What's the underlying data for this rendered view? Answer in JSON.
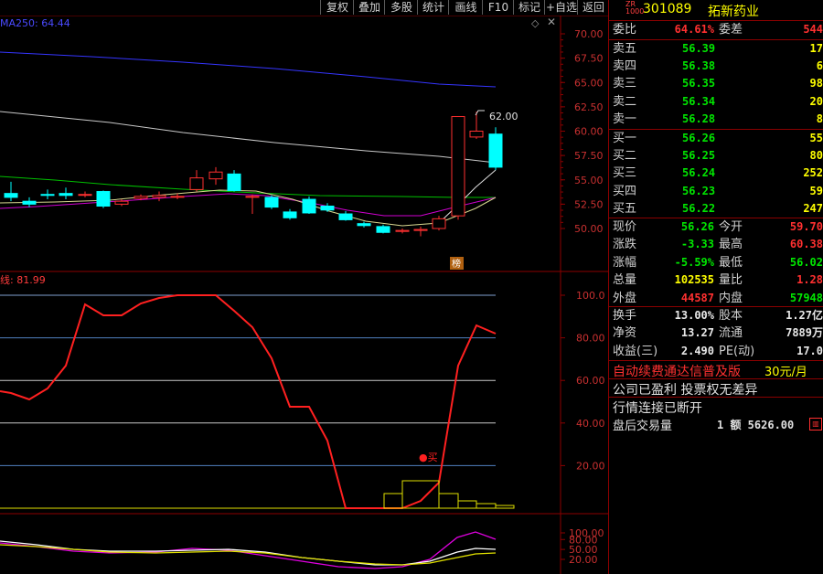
{
  "toolbar": {
    "items": [
      "复权",
      "叠加",
      "多股",
      "统计",
      "画线",
      "F10",
      "标记",
      "+自选",
      "返回"
    ]
  },
  "main_chart": {
    "ma_label": "MA250: 64.44",
    "peak_label": "62.00",
    "y_ticks": [
      "70.00",
      "67.50",
      "65.00",
      "62.50",
      "60.00",
      "57.50",
      "55.00",
      "52.50",
      "50.00"
    ],
    "badge": "榜",
    "close_icon": "close-icon",
    "diamond_icon": "diamond-icon",
    "colors": {
      "up": "#ff3030",
      "down": "#00ffff",
      "ma250": "#3535ff",
      "ma_white": "#c8c8c8",
      "ma_green": "#00c000",
      "ma_magenta": "#d000d0",
      "ma_yellow": "#ffff60"
    }
  },
  "indicator": {
    "label": "线: 81.99",
    "buy_label": "●买",
    "y_ticks": [
      "100.0",
      "80.00",
      "60.00",
      "40.00",
      "20.00"
    ]
  },
  "sub_indicator": {
    "y_ticks": [
      "100.00",
      "80.00",
      "50.00",
      "20.00"
    ]
  },
  "stock": {
    "market_tag": "ZR\n1000",
    "code": "301089",
    "name": "拓新药业"
  },
  "weibi": {
    "label": "委比",
    "value": "64.61%",
    "label2": "委差",
    "value2": "544"
  },
  "asks": [
    {
      "label": "卖五",
      "price": "56.39",
      "vol": "17"
    },
    {
      "label": "卖四",
      "price": "56.38",
      "vol": "6"
    },
    {
      "label": "卖三",
      "price": "56.35",
      "vol": "98"
    },
    {
      "label": "卖二",
      "price": "56.34",
      "vol": "20"
    },
    {
      "label": "卖一",
      "price": "56.28",
      "vol": "8"
    }
  ],
  "bids": [
    {
      "label": "买一",
      "price": "56.26",
      "vol": "55"
    },
    {
      "label": "买二",
      "price": "56.25",
      "vol": "80"
    },
    {
      "label": "买三",
      "price": "56.24",
      "vol": "252"
    },
    {
      "label": "买四",
      "price": "56.23",
      "vol": "59"
    },
    {
      "label": "买五",
      "price": "56.22",
      "vol": "247"
    }
  ],
  "quote": [
    {
      "l1": "现价",
      "v1": "56.26",
      "c1": "green",
      "l2": "今开",
      "v2": "59.70",
      "c2": "red"
    },
    {
      "l1": "涨跌",
      "v1": "-3.33",
      "c1": "green",
      "l2": "最高",
      "v2": "60.38",
      "c2": "red"
    },
    {
      "l1": "涨幅",
      "v1": "-5.59%",
      "c1": "green",
      "l2": "最低",
      "v2": "56.02",
      "c2": "green"
    },
    {
      "l1": "总量",
      "v1": "102535",
      "c1": "yellow",
      "l2": "量比",
      "v2": "1.28",
      "c2": "red"
    },
    {
      "l1": "外盘",
      "v1": "44587",
      "c1": "red",
      "l2": "内盘",
      "v2": "57948",
      "c2": "green"
    }
  ],
  "fin": [
    {
      "l1": "换手",
      "v1": "13.00%",
      "l2": "股本",
      "v2": "1.27亿"
    },
    {
      "l1": "净资",
      "v1": "13.27",
      "l2": "流通",
      "v2": "7889万"
    },
    {
      "l1": "收益(三)",
      "v1": "2.490",
      "l2": "PE(动)",
      "v2": "17.0"
    }
  ],
  "ad": {
    "text": "自动续费通达信普及版",
    "price": "30元/月"
  },
  "notes": [
    "公司已盈利 投票权无差异",
    "行情连接已断开"
  ],
  "after_hours": {
    "label": "盘后交易量",
    "amount": "1 额 5626.00",
    "icon": "chart-icon"
  }
}
